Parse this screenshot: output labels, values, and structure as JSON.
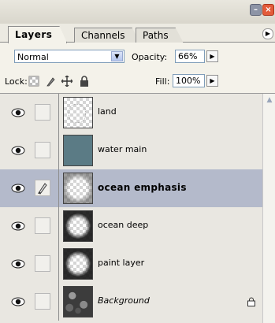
{
  "tabs": [
    {
      "label": "Layers",
      "active": true
    },
    {
      "label": "Channels",
      "active": false
    },
    {
      "label": "Paths",
      "active": false
    }
  ],
  "blend": {
    "mode": "Normal",
    "opacity_label": "Opacity:",
    "opacity_value": "66%"
  },
  "lock": {
    "label": "Lock:",
    "fill_label": "Fill:",
    "fill_value": "100%"
  },
  "layers": [
    {
      "name": "land",
      "thumbnail": "transparent-land",
      "visible": true,
      "selected": false,
      "locked": false
    },
    {
      "name": "water main",
      "thumbnail": "solid-teal",
      "visible": true,
      "selected": false,
      "locked": false
    },
    {
      "name": "ocean emphasis",
      "thumbnail": "transparent-light-ring",
      "visible": true,
      "selected": true,
      "locked": false,
      "brush": true
    },
    {
      "name": "ocean deep",
      "thumbnail": "transparent-dark-ring",
      "visible": true,
      "selected": false,
      "locked": false
    },
    {
      "name": "paint layer",
      "thumbnail": "transparent-dark-ring",
      "visible": true,
      "selected": false,
      "locked": false
    },
    {
      "name": "Background",
      "thumbnail": "rough-texture",
      "visible": true,
      "selected": false,
      "locked": true
    }
  ],
  "colors": {
    "selected_row": "#b4bacb",
    "teal_thumb": "#5b7b85"
  }
}
